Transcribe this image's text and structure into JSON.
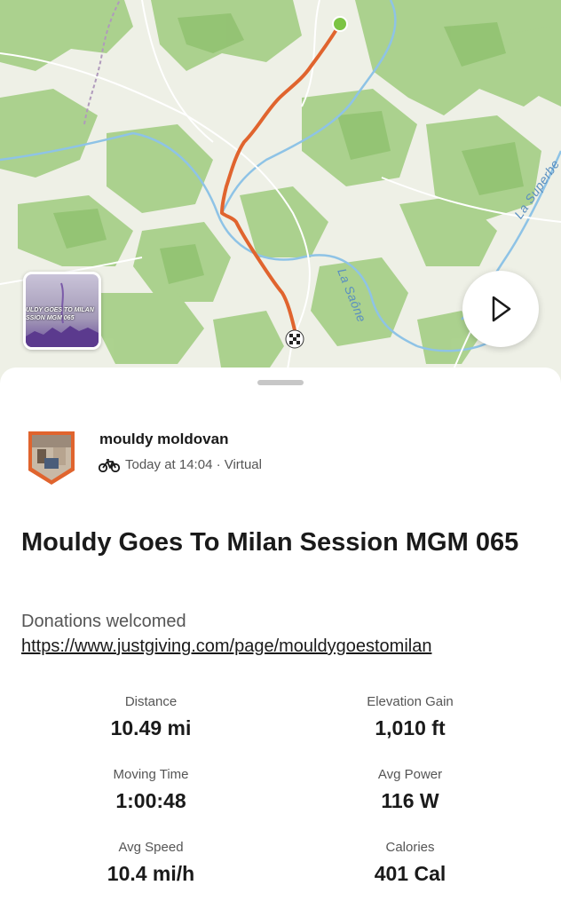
{
  "map": {
    "labels": {
      "river_saone": "La Saône",
      "river_superbe": "La Superbe"
    },
    "photo_thumbnail_text": "ULDY GOES TO MILAN\nSSION MGM 065",
    "route_color": "#e0642e",
    "start_color": "#7cc444",
    "water_color": "#8ec3e6",
    "forest_color": "#a8d08a"
  },
  "athlete": {
    "name": "mouldy moldovan",
    "time": "Today at 14:04 · Virtual",
    "activity_icon": "bike-icon"
  },
  "activity": {
    "title": "Mouldy Goes To Milan Session MGM 065",
    "description": "Donations welcomed",
    "link": "https://www.justgiving.com/page/mouldygoestomilan"
  },
  "stats": [
    {
      "label": "Distance",
      "value": "10.49 mi"
    },
    {
      "label": "Elevation Gain",
      "value": "1,010 ft"
    },
    {
      "label": "Moving Time",
      "value": "1:00:48"
    },
    {
      "label": "Avg Power",
      "value": "116 W"
    },
    {
      "label": "Avg Speed",
      "value": "10.4 mi/h"
    },
    {
      "label": "Calories",
      "value": "401 Cal"
    }
  ]
}
